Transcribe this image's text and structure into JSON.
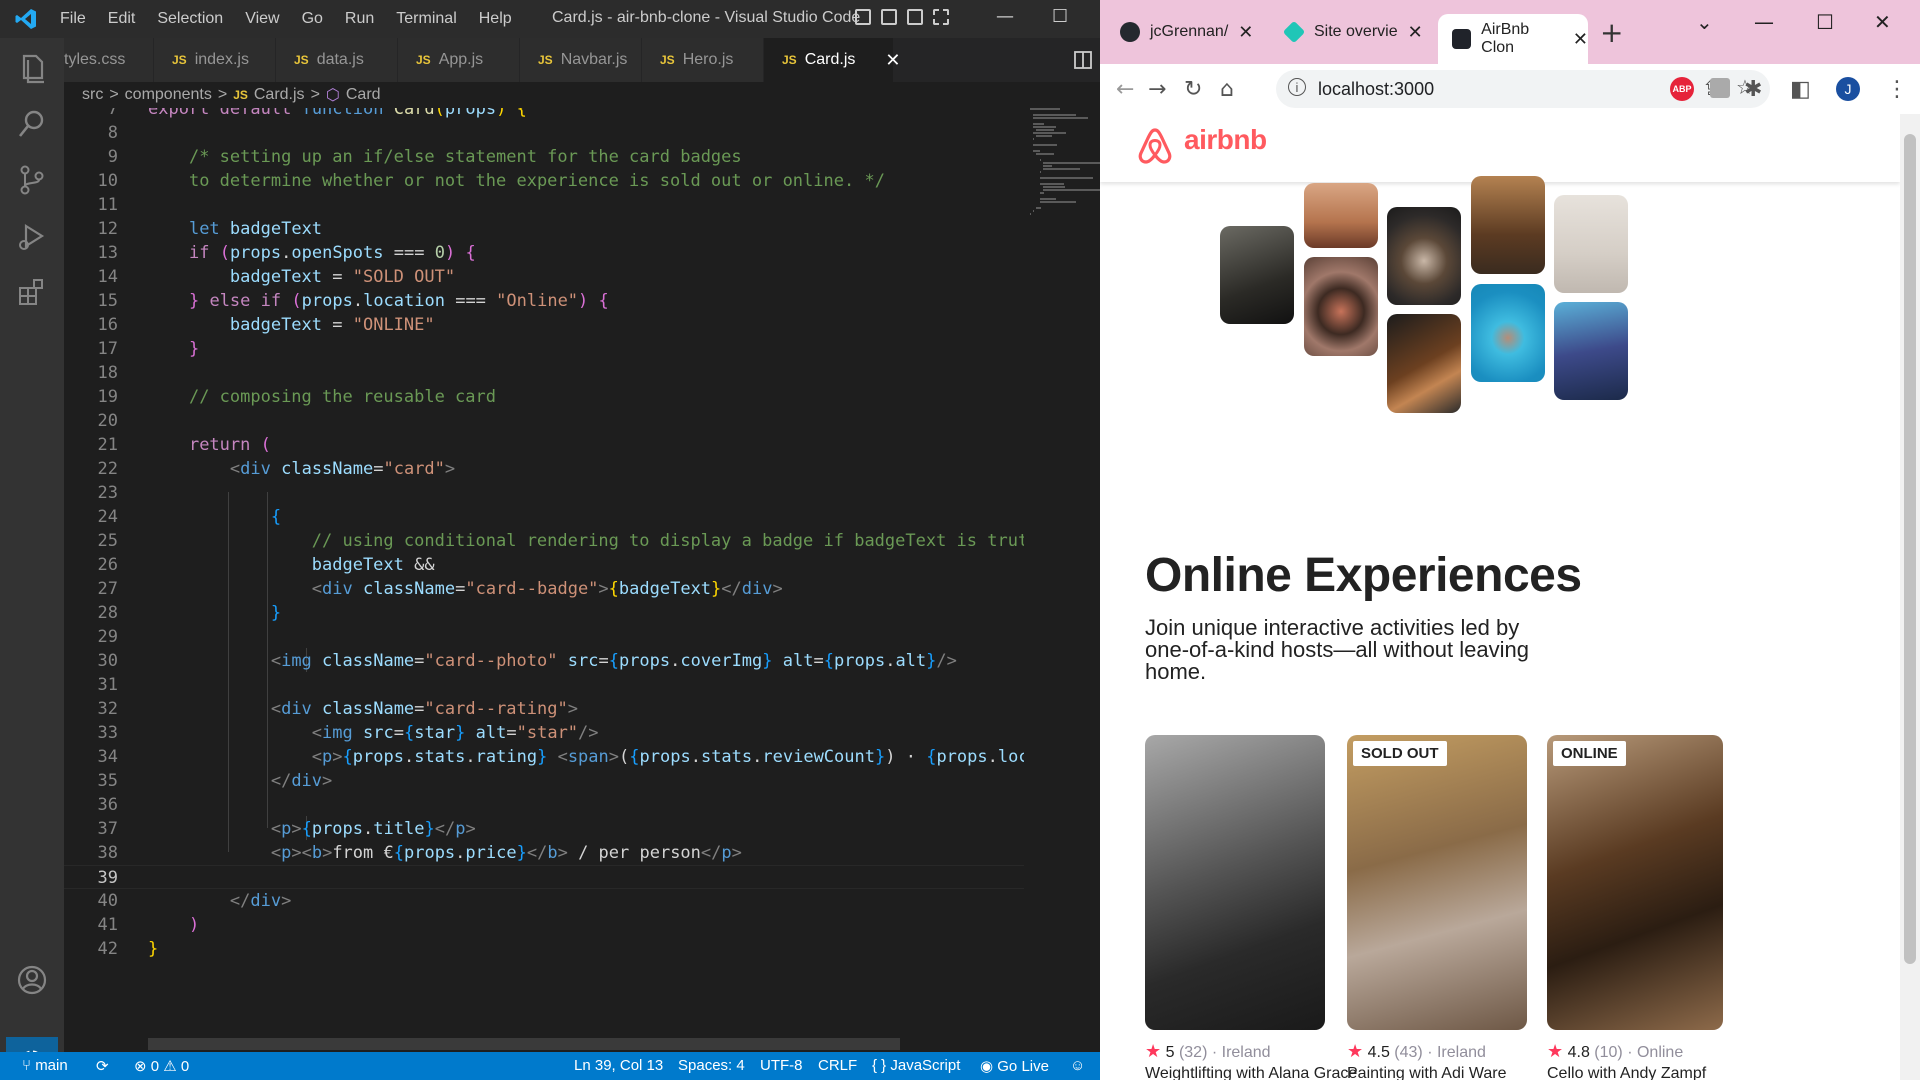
{
  "vscode": {
    "menu": [
      "File",
      "Edit",
      "Selection",
      "View",
      "Go",
      "Run",
      "Terminal",
      "Help"
    ],
    "window_title": "Card.js - air-bnb-clone - Visual Studio Code",
    "tabs": [
      {
        "label": "tyles.css",
        "js": false
      },
      {
        "label": "index.js",
        "js": true
      },
      {
        "label": "data.js",
        "js": true
      },
      {
        "label": "App.js",
        "js": true
      },
      {
        "label": "Navbar.js",
        "js": true
      },
      {
        "label": "Hero.js",
        "js": true
      },
      {
        "label": "Card.js",
        "js": true,
        "active": true
      }
    ],
    "js_badge": "JS",
    "breadcrumb": {
      "folder1": "src",
      "folder2": "components",
      "file": "Card.js",
      "symbol": "Card",
      "sep": ">"
    },
    "current_line": 39,
    "code_lines": [
      {
        "n": 7,
        "html": "<span class=\"kw2\">export</span> <span class=\"kw2\">default</span> <span class=\"kw\">function</span> <span class=\"fn\">Card</span><span class=\"br1\">(</span><span class=\"var\">props</span><span class=\"br1\">)</span> <span class=\"br1\">{</span>"
      },
      {
        "n": 8,
        "html": ""
      },
      {
        "n": 9,
        "html": "    <span class=\"cm\">/* setting up an if/else statement for the card badges</span>"
      },
      {
        "n": 10,
        "html": "    <span class=\"cm\">to determine whether or not the experience is sold out or online. */</span>"
      },
      {
        "n": 11,
        "html": ""
      },
      {
        "n": 12,
        "html": "    <span class=\"kw\">let</span> <span class=\"var\">badgeText</span>"
      },
      {
        "n": 13,
        "html": "    <span class=\"kw2\">if</span> <span class=\"br\">(</span><span class=\"var\">props</span>.<span class=\"var\">openSpots</span> === <span class=\"num\">0</span><span class=\"br\">)</span> <span class=\"br\">{</span>"
      },
      {
        "n": 14,
        "html": "        <span class=\"var\">badgeText</span> = <span class=\"str\">\"SOLD OUT\"</span>"
      },
      {
        "n": 15,
        "html": "    <span class=\"br\">}</span> <span class=\"kw2\">else</span> <span class=\"kw2\">if</span> <span class=\"br\">(</span><span class=\"var\">props</span>.<span class=\"var\">location</span> === <span class=\"str\">\"Online\"</span><span class=\"br\">)</span> <span class=\"br\">{</span>"
      },
      {
        "n": 16,
        "html": "        <span class=\"var\">badgeText</span> = <span class=\"str\">\"ONLINE\"</span>"
      },
      {
        "n": 17,
        "html": "    <span class=\"br\">}</span>"
      },
      {
        "n": 18,
        "html": ""
      },
      {
        "n": 19,
        "html": "    <span class=\"cm\">// composing the reusable card</span>"
      },
      {
        "n": 20,
        "html": ""
      },
      {
        "n": 21,
        "html": "    <span class=\"kw2\">return</span> <span class=\"br\">(</span>"
      },
      {
        "n": 22,
        "html": "        <span class=\"tag\">&lt;</span><span class=\"tg\">div</span> <span class=\"attr\">className</span>=<span class=\"str\">\"card\"</span><span class=\"tag\">&gt;</span>"
      },
      {
        "n": 23,
        "html": ""
      },
      {
        "n": 24,
        "html": "            <span class=\"br2\">{</span>"
      },
      {
        "n": 25,
        "html": "                <span class=\"cm\">// using conditional rendering to display a badge if badgeText is truthy.</span>"
      },
      {
        "n": 26,
        "html": "                <span class=\"var\">badgeText</span> &amp;&amp;"
      },
      {
        "n": 27,
        "html": "                <span class=\"tag\">&lt;</span><span class=\"tg\">div</span> <span class=\"attr\">className</span>=<span class=\"str\">\"card--badge\"</span><span class=\"tag\">&gt;</span><span class=\"br1\">{</span><span class=\"var\">badgeText</span><span class=\"br1\">}</span><span class=\"tag\">&lt;/</span><span class=\"tg\">div</span><span class=\"tag\">&gt;</span>"
      },
      {
        "n": 28,
        "html": "            <span class=\"br2\">}</span>"
      },
      {
        "n": 29,
        "html": ""
      },
      {
        "n": 30,
        "html": "            <span class=\"tag\">&lt;</span><span class=\"tg\">img</span> <span class=\"attr\">className</span>=<span class=\"str\">\"card--photo\"</span> <span class=\"attr\">src</span>=<span class=\"br2\">{</span><span class=\"var\">props</span>.<span class=\"var\">coverImg</span><span class=\"br2\">}</span> <span class=\"attr\">alt</span>=<span class=\"br2\">{</span><span class=\"var\">props</span>.<span class=\"var\">alt</span><span class=\"br2\">}</span><span class=\"tag\">/&gt;</span>"
      },
      {
        "n": 31,
        "html": ""
      },
      {
        "n": 32,
        "html": "            <span class=\"tag\">&lt;</span><span class=\"tg\">div</span> <span class=\"attr\">className</span>=<span class=\"str\">\"card--rating\"</span><span class=\"tag\">&gt;</span>"
      },
      {
        "n": 33,
        "html": "                <span class=\"tag\">&lt;</span><span class=\"tg\">img</span> <span class=\"attr\">src</span>=<span class=\"br2\">{</span><span class=\"var\">star</span><span class=\"br2\">}</span> <span class=\"attr\">alt</span>=<span class=\"str\">\"star\"</span><span class=\"tag\">/&gt;</span>"
      },
      {
        "n": 34,
        "html": "                <span class=\"tag\">&lt;</span><span class=\"tg\">p</span><span class=\"tag\">&gt;</span><span class=\"br2\">{</span><span class=\"var\">props</span>.<span class=\"var\">stats</span>.<span class=\"var\">rating</span><span class=\"br2\">}</span> <span class=\"tag\">&lt;</span><span class=\"tg\">span</span><span class=\"tag\">&gt;</span>(<span class=\"br2\">{</span><span class=\"var\">props</span>.<span class=\"var\">stats</span>.<span class=\"var\">reviewCount</span><span class=\"br2\">}</span>) · <span class=\"br2\">{</span><span class=\"var\">props</span>.<span class=\"var\">location</span>"
      },
      {
        "n": 35,
        "html": "            <span class=\"tag\">&lt;/</span><span class=\"tg\">div</span><span class=\"tag\">&gt;</span>"
      },
      {
        "n": 36,
        "html": ""
      },
      {
        "n": 37,
        "html": "            <span class=\"tag\">&lt;</span><span class=\"tg\">p</span><span class=\"tag\">&gt;</span><span class=\"br2\">{</span><span class=\"var\">props</span>.<span class=\"var\">title</span><span class=\"br2\">}</span><span class=\"tag\">&lt;/</span><span class=\"tg\">p</span><span class=\"tag\">&gt;</span>"
      },
      {
        "n": 38,
        "html": "            <span class=\"tag\">&lt;</span><span class=\"tg\">p</span><span class=\"tag\">&gt;&lt;</span><span class=\"tg\">b</span><span class=\"tag\">&gt;</span>from €<span class=\"br2\">{</span><span class=\"var\">props</span>.<span class=\"var\">price</span><span class=\"br2\">}</span><span class=\"tag\">&lt;/</span><span class=\"tg\">b</span><span class=\"tag\">&gt;</span> / per person<span class=\"tag\">&lt;/</span><span class=\"tg\">p</span><span class=\"tag\">&gt;</span>"
      },
      {
        "n": 39,
        "html": ""
      },
      {
        "n": 40,
        "html": "        <span class=\"tag\">&lt;/</span><span class=\"tg\">div</span><span class=\"tag\">&gt;</span>"
      },
      {
        "n": 41,
        "html": "    <span class=\"br\">)</span>"
      },
      {
        "n": 42,
        "html": "<span class=\"br1\">}</span>"
      }
    ],
    "status": {
      "branch": "main",
      "errors": "0",
      "warnings": "0",
      "position": "Ln 39, Col 13",
      "spaces": "Spaces: 4",
      "encoding": "UTF-8",
      "eol": "CRLF",
      "language": "JavaScript",
      "go_live": "Go Live"
    }
  },
  "chrome": {
    "tabs": [
      {
        "label": "jcGrennan/",
        "favicon_color": "#24292f"
      },
      {
        "label": "Site overvie",
        "favicon_color": "#20c6b7"
      },
      {
        "label": "AirBnb Clon",
        "favicon_color": "#20232a",
        "active": true
      }
    ],
    "url": "localhost:3000",
    "profile_initial": "J",
    "ext_abp": "ABP"
  },
  "airbnb": {
    "logo_text": "airbnb",
    "brand_color": "#ff5a5f",
    "hero_title": "Online Experiences",
    "hero_subtitle": "Join unique interactive activities led by one-of-a-kind hosts—all without leaving home.",
    "cards": [
      {
        "badge": "",
        "rating": "5",
        "reviews": "(32)",
        "location": "Ireland",
        "title": "Weightlifting with Alana Grace"
      },
      {
        "badge": "SOLD OUT",
        "rating": "4.5",
        "reviews": "(43)",
        "location": "Ireland",
        "title": "Painting with Adi Ware"
      },
      {
        "badge": "ONLINE",
        "rating": "4.8",
        "reviews": "(10)",
        "location": "Online",
        "title": "Cello with Andy Zampf"
      }
    ]
  }
}
